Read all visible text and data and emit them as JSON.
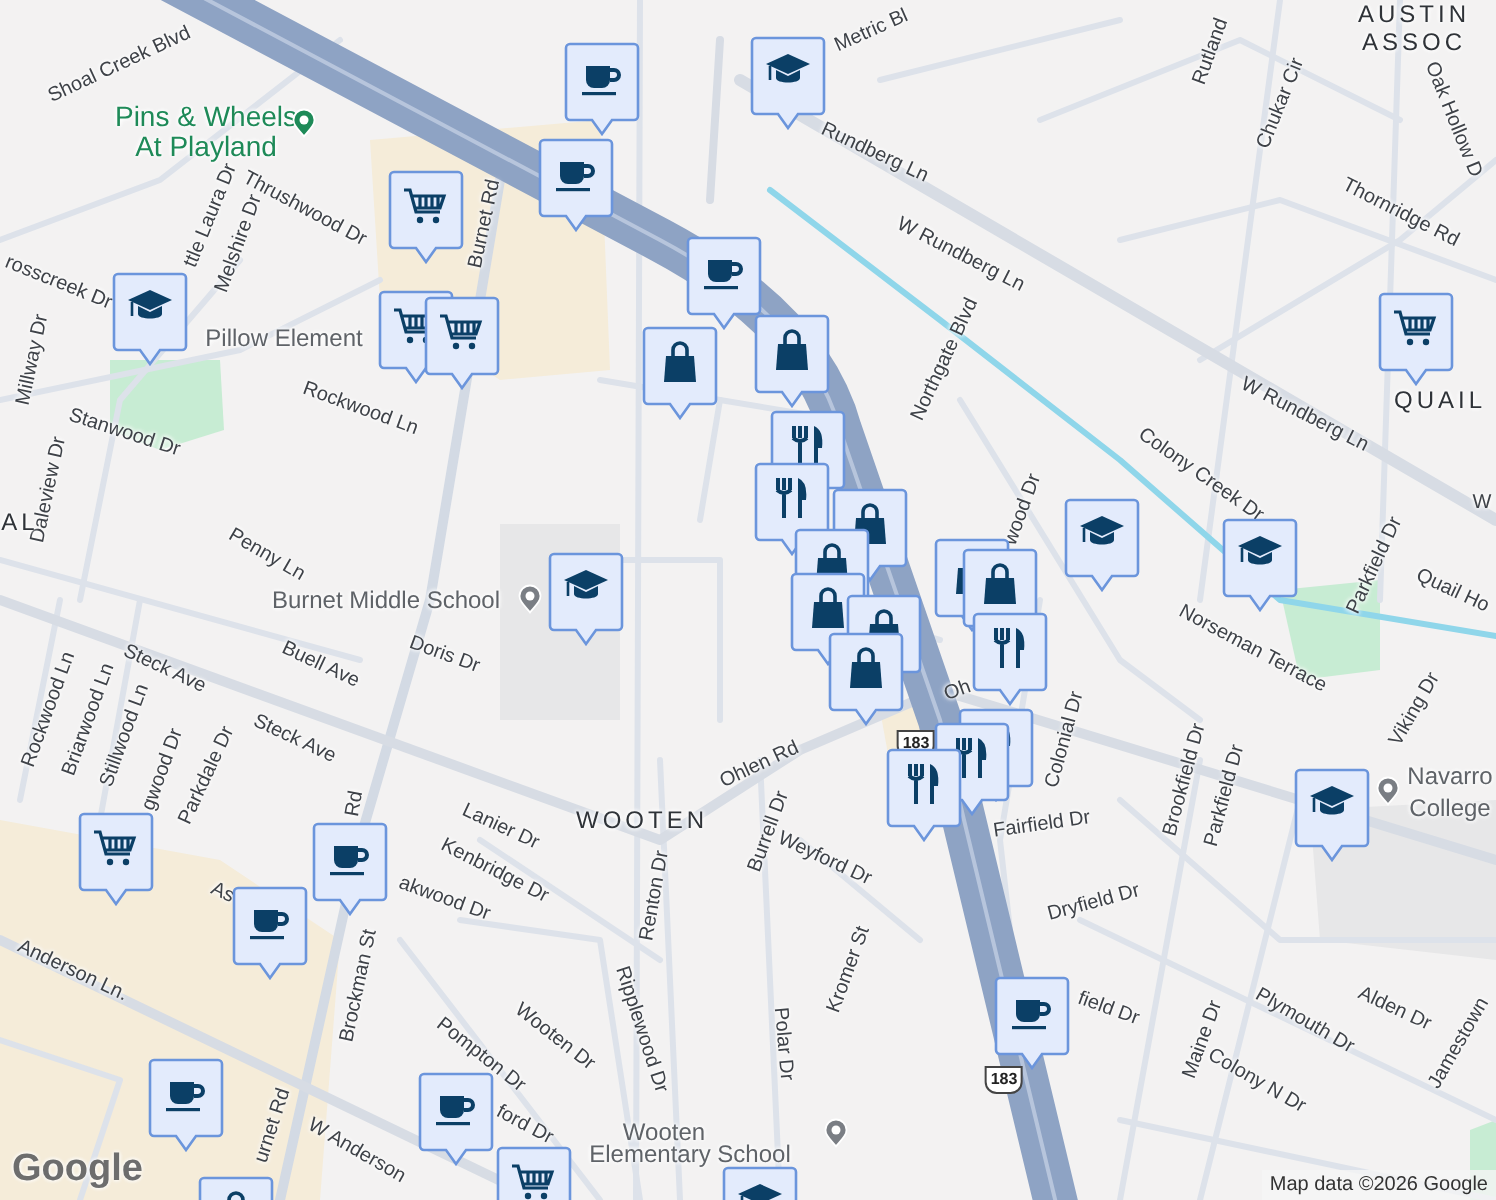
{
  "map": {
    "labels": [
      {
        "text": "Metric Bl",
        "kind": "street"
      },
      {
        "text": "Rutland",
        "kind": "street"
      },
      {
        "text": "AUSTIN",
        "kind": "area"
      },
      {
        "text": "ASSOC",
        "kind": "area"
      },
      {
        "text": "Shoal Creek Blvd",
        "kind": "street"
      },
      {
        "text": "Pins & Wheels",
        "kind": "poi"
      },
      {
        "text": "At Playland",
        "kind": "poi"
      },
      {
        "text": "Chukar Cir",
        "kind": "street"
      },
      {
        "text": "Oak Hollow D",
        "kind": "street"
      },
      {
        "text": "Rundberg Ln",
        "kind": "street"
      },
      {
        "text": "Thornridge Rd",
        "kind": "street"
      },
      {
        "text": "Thrushwood Dr",
        "kind": "street"
      },
      {
        "text": "ttle Laura Dr",
        "kind": "street"
      },
      {
        "text": "Melshire Dr",
        "kind": "street"
      },
      {
        "text": "Burnet Rd",
        "kind": "street"
      },
      {
        "text": "W Rundberg Ln",
        "kind": "street"
      },
      {
        "text": "rosscreek Dr",
        "kind": "street"
      },
      {
        "text": "Pillow Element",
        "kind": "school"
      },
      {
        "text": "Millway Dr",
        "kind": "street"
      },
      {
        "text": "Northgate Blvd",
        "kind": "street"
      },
      {
        "text": "W Rundberg Ln",
        "kind": "street"
      },
      {
        "text": "QUAIL",
        "kind": "area"
      },
      {
        "text": "Rockwood Ln",
        "kind": "street"
      },
      {
        "text": "Stanwood Dr",
        "kind": "street"
      },
      {
        "text": "Daleview Dr",
        "kind": "street"
      },
      {
        "text": "Colony Creek Dr",
        "kind": "street"
      },
      {
        "text": "wood Dr",
        "kind": "street"
      },
      {
        "text": "W",
        "kind": "street"
      },
      {
        "text": "AL",
        "kind": "area"
      },
      {
        "text": "Parkfield Dr",
        "kind": "street"
      },
      {
        "text": "Quail Ho",
        "kind": "street"
      },
      {
        "text": "Penny Ln",
        "kind": "street"
      },
      {
        "text": "Burnet Middle School",
        "kind": "school"
      },
      {
        "text": "Doris Dr",
        "kind": "street"
      },
      {
        "text": "Norseman Terrace",
        "kind": "street"
      },
      {
        "text": "Steck Ave",
        "kind": "street"
      },
      {
        "text": "Buell Ave",
        "kind": "street"
      },
      {
        "text": "Viking Dr",
        "kind": "street"
      },
      {
        "text": "Rockwood Ln",
        "kind": "street"
      },
      {
        "text": "Briarwood Ln",
        "kind": "street"
      },
      {
        "text": "Stillwood Ln",
        "kind": "street"
      },
      {
        "text": "gwood Dr",
        "kind": "street"
      },
      {
        "text": "Parkdale Dr",
        "kind": "street"
      },
      {
        "text": "Steck Ave",
        "kind": "street"
      },
      {
        "text": "Oh",
        "kind": "street"
      },
      {
        "text": "Colonial Dr",
        "kind": "street"
      },
      {
        "text": "Ohlen Rd",
        "kind": "street"
      },
      {
        "text": "Navarro",
        "kind": "school"
      },
      {
        "text": "College",
        "kind": "school"
      },
      {
        "text": "Rd",
        "kind": "street"
      },
      {
        "text": "Brookfield Dr",
        "kind": "street"
      },
      {
        "text": "Parkfield Dr",
        "kind": "street"
      },
      {
        "text": "WOOTEN",
        "kind": "area"
      },
      {
        "text": "Lanier Dr",
        "kind": "street"
      },
      {
        "text": "Fairfield Dr",
        "kind": "street"
      },
      {
        "text": "Burrell Dr",
        "kind": "street"
      },
      {
        "text": "Weyford Dr",
        "kind": "street"
      },
      {
        "text": "Kenbridge Dr",
        "kind": "street"
      },
      {
        "text": "akwood Dr",
        "kind": "street"
      },
      {
        "text": "Renton Dr",
        "kind": "street"
      },
      {
        "text": "Dryfield Dr",
        "kind": "street"
      },
      {
        "text": "As",
        "kind": "street"
      },
      {
        "text": "Anderson Ln.",
        "kind": "street"
      },
      {
        "text": "Kromer St",
        "kind": "street"
      },
      {
        "text": "Brockman St",
        "kind": "street"
      },
      {
        "text": "Ripplewood Dr",
        "kind": "street"
      },
      {
        "text": "field Dr",
        "kind": "street"
      },
      {
        "text": "Polar Dr",
        "kind": "street"
      },
      {
        "text": "Wooten Dr",
        "kind": "street"
      },
      {
        "text": "Pompton Dr",
        "kind": "street"
      },
      {
        "text": "Alden Dr",
        "kind": "street"
      },
      {
        "text": "Plymouth Dr",
        "kind": "street"
      },
      {
        "text": "Maine Dr",
        "kind": "street"
      },
      {
        "text": "Jamestown",
        "kind": "street"
      },
      {
        "text": "Colony N Dr",
        "kind": "street"
      },
      {
        "text": "ford Dr",
        "kind": "street"
      },
      {
        "text": "Wooten",
        "kind": "school"
      },
      {
        "text": "Elementary School",
        "kind": "school"
      },
      {
        "text": "urnet Rd",
        "kind": "street"
      },
      {
        "text": "W Anderson",
        "kind": "street"
      },
      {
        "text": "183",
        "kind": "shield"
      },
      {
        "text": "183",
        "kind": "shield"
      }
    ],
    "markers": [
      {
        "kind": "cafe"
      },
      {
        "kind": "cafe"
      },
      {
        "kind": "school"
      },
      {
        "kind": "grocery"
      },
      {
        "kind": "cafe"
      },
      {
        "kind": "school"
      },
      {
        "kind": "grocery"
      },
      {
        "kind": "grocery"
      },
      {
        "kind": "shop"
      },
      {
        "kind": "shop"
      },
      {
        "kind": "restaurant"
      },
      {
        "kind": "restaurant"
      },
      {
        "kind": "shop"
      },
      {
        "kind": "shop"
      },
      {
        "kind": "school"
      },
      {
        "kind": "shop"
      },
      {
        "kind": "shop"
      },
      {
        "kind": "school"
      },
      {
        "kind": "school"
      },
      {
        "kind": "grocery"
      },
      {
        "kind": "shop"
      },
      {
        "kind": "shop"
      },
      {
        "kind": "restaurant"
      },
      {
        "kind": "shop"
      },
      {
        "kind": "restaurant"
      },
      {
        "kind": "restaurant"
      },
      {
        "kind": "restaurant"
      },
      {
        "kind": "school"
      },
      {
        "kind": "grocery"
      },
      {
        "kind": "cafe"
      },
      {
        "kind": "cafe"
      },
      {
        "kind": "cafe"
      },
      {
        "kind": "cafe"
      },
      {
        "kind": "cafe"
      },
      {
        "kind": "grocery"
      },
      {
        "kind": "shop"
      },
      {
        "kind": "school"
      }
    ],
    "logo": "Google",
    "attribution": "Map data ©2026 Google"
  }
}
